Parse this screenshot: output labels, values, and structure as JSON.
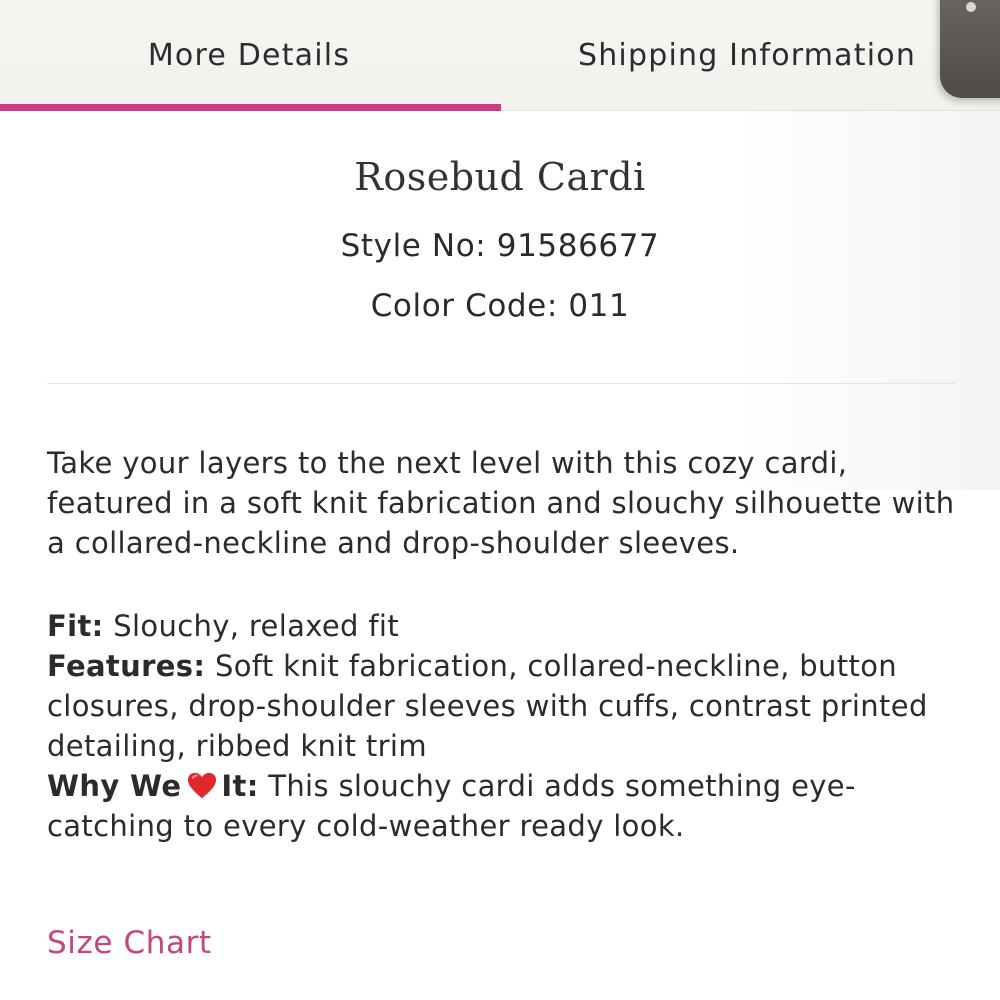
{
  "tabs": {
    "details_label": "More Details",
    "shipping_label": "Shipping Information",
    "active_color": "#c93d82"
  },
  "product": {
    "title": "Rosebud Cardi",
    "style_line": "Style No: 91586677",
    "color_line": "Color Code: 011"
  },
  "description": "Take your layers to the next level with this cozy cardi, featured in a soft knit fabrication and slouchy silhouette with a collared-neckline and drop-shoulder sleeves.",
  "details": {
    "fit_label": "Fit:",
    "fit_value": "Slouchy, relaxed fit",
    "features_label": "Features:",
    "features_value": "Soft knit fabrication, collared-neckline, button closures, drop-shoulder sleeves with cuffs, contrast printed detailing, ribbed knit trim",
    "why_label_start": "Why We",
    "why_label_end": "It:",
    "why_icon": "heart-icon",
    "why_value": "This slouchy cardi adds something eye-catching to every cold-weather ready look."
  },
  "links": {
    "size_chart": "Size Chart",
    "link_color": "#c4467f"
  }
}
